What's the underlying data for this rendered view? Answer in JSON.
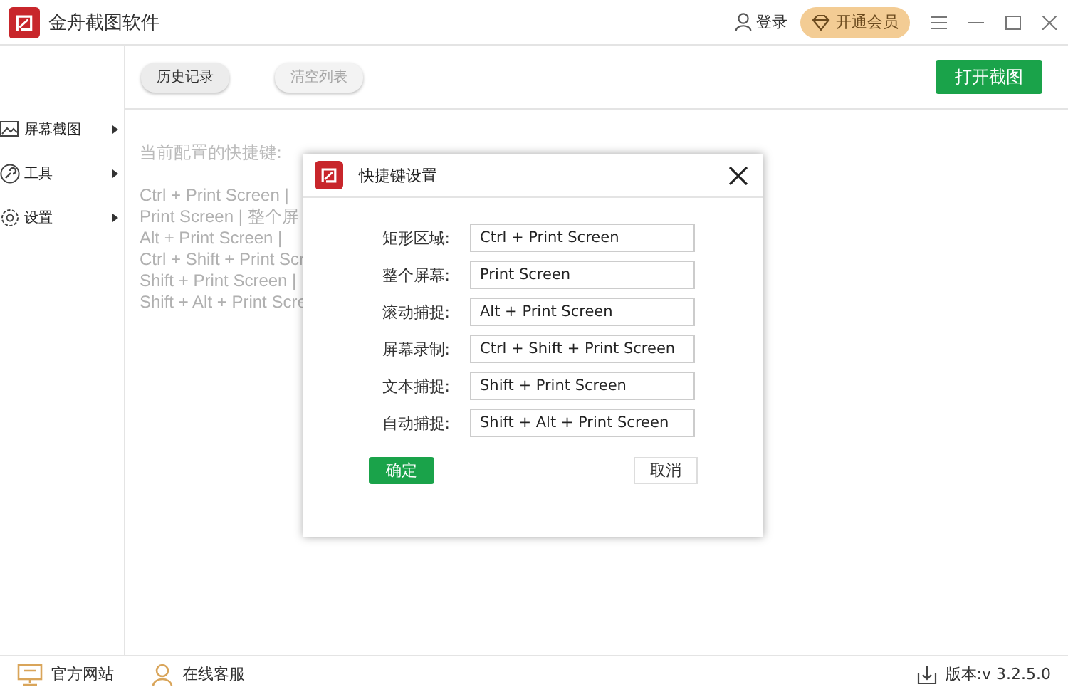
{
  "window": {
    "title": "金舟截图软件",
    "login": "登录",
    "vip": "开通会员"
  },
  "toolbar": {
    "buttons": [
      {
        "label": "历史记录",
        "disabled": false
      },
      {
        "label": "清空列表",
        "disabled": true
      }
    ],
    "primary": "打开截图"
  },
  "sidebar": {
    "items": [
      {
        "kind": "picture",
        "label": "屏幕截图"
      },
      {
        "kind": "tools",
        "label": "工具"
      },
      {
        "kind": "settings",
        "label": "设置"
      }
    ]
  },
  "content": {
    "heading": "当前配置的快捷键:",
    "lines": [
      "Ctrl + Print Screen  |",
      "Print Screen  |  整个屏",
      "Alt + Print Screen  |",
      "Ctrl + Shift + Print Scr",
      "Shift + Print Screen  |",
      "Shift + Alt + Print Scre"
    ]
  },
  "dialog": {
    "title": "快捷键设置",
    "rows": [
      {
        "label": "矩形区域:",
        "value": "Ctrl + Print Screen"
      },
      {
        "label": "整个屏幕:",
        "value": "Print Screen"
      },
      {
        "label": "滚动捕捉:",
        "value": "Alt + Print Screen"
      },
      {
        "label": "屏幕录制:",
        "value": "Ctrl + Shift + Print Screen"
      },
      {
        "label": "文本捕捉:",
        "value": "Shift + Print Screen"
      },
      {
        "label": "自动捕捉:",
        "value": "Shift + Alt + Print Screen"
      }
    ],
    "ok": "确定",
    "cancel": "取消"
  },
  "footer": {
    "website": "官方网站",
    "service": "在线客服",
    "version": "版本:v 3.2.5.0"
  }
}
